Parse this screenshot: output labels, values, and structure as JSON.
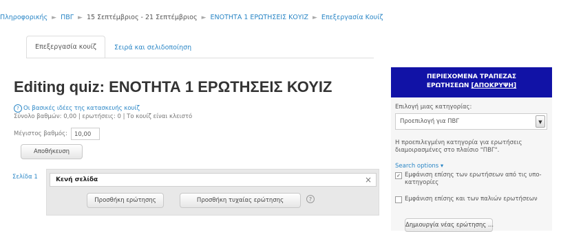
{
  "breadcrumb": {
    "items": [
      "Πληροφορικής",
      "ΠΒΓ",
      "15 Σεπτέμβριος - 21 Σεπτέμβριος",
      "ΕΝΟΤΗΤΑ 1 ΕΡΩΤΗΣΕΙΣ ΚΟΥΙΖ",
      "Επεξεργασία Κουίζ"
    ],
    "separator": "►"
  },
  "tabs": [
    {
      "label": "Επεξεργασία κουίζ",
      "active": true
    },
    {
      "label": "Σειρά και σελιδοποίηση",
      "active": false
    }
  ],
  "page_title": "Editing quiz: ΕΝΟΤΗΤΑ 1 ΕΡΩΤΗΣΕΙΣ ΚΟΥΙΖ",
  "info": {
    "help_link": "Οι βασικές ιδέες της κατασκευής κουίζ",
    "summary": "Σύνολο βαθμών: 0,00 | ερωτήσεις: 0 | Το κουίζ είναι κλειστό"
  },
  "max_grade": {
    "label": "Μέγιστος βαθμός",
    "value": "10,00"
  },
  "buttons": {
    "save": "Αποθήκευση",
    "add_question": "Προσθήκη ερώτησης",
    "add_random_question": "Προσθήκη τυχαίας ερώτησης"
  },
  "section": {
    "page_label": "Σελίδα 1",
    "heading": "Κενή σελίδα",
    "close": "×"
  },
  "question_bank": {
    "header_line1": "ΠΕΡΙΕΧΟΜΕΝΑ ΤΡΑΠΕΖΑΣ",
    "header_line2": "ΕΡΩΤΗΣΕΩΝ",
    "hide_link": "[ΑΠΟΚΡΥΨΗ]",
    "category_label": "Επιλογή μιας κατηγορίας:",
    "category_value": "Προεπιλογή για ΠΒΓ",
    "category_note": "Η προεπιλεγμένη κατηγορία για ερωτήσεις διαμοιρασμένες στο πλαίσιο \"ΠΒΓ\".",
    "search_options": "Search options ▾",
    "option1": "Εμφάνιση επίσης των ερωτήσεων από τις υπο-κατηγορίες",
    "option1_checked": true,
    "option2": "Εμφάνιση επίσης και των παλιών ερωτήσεων",
    "option2_checked": false,
    "create_button": "Δημιουργία νέας ερώτησης ..."
  }
}
